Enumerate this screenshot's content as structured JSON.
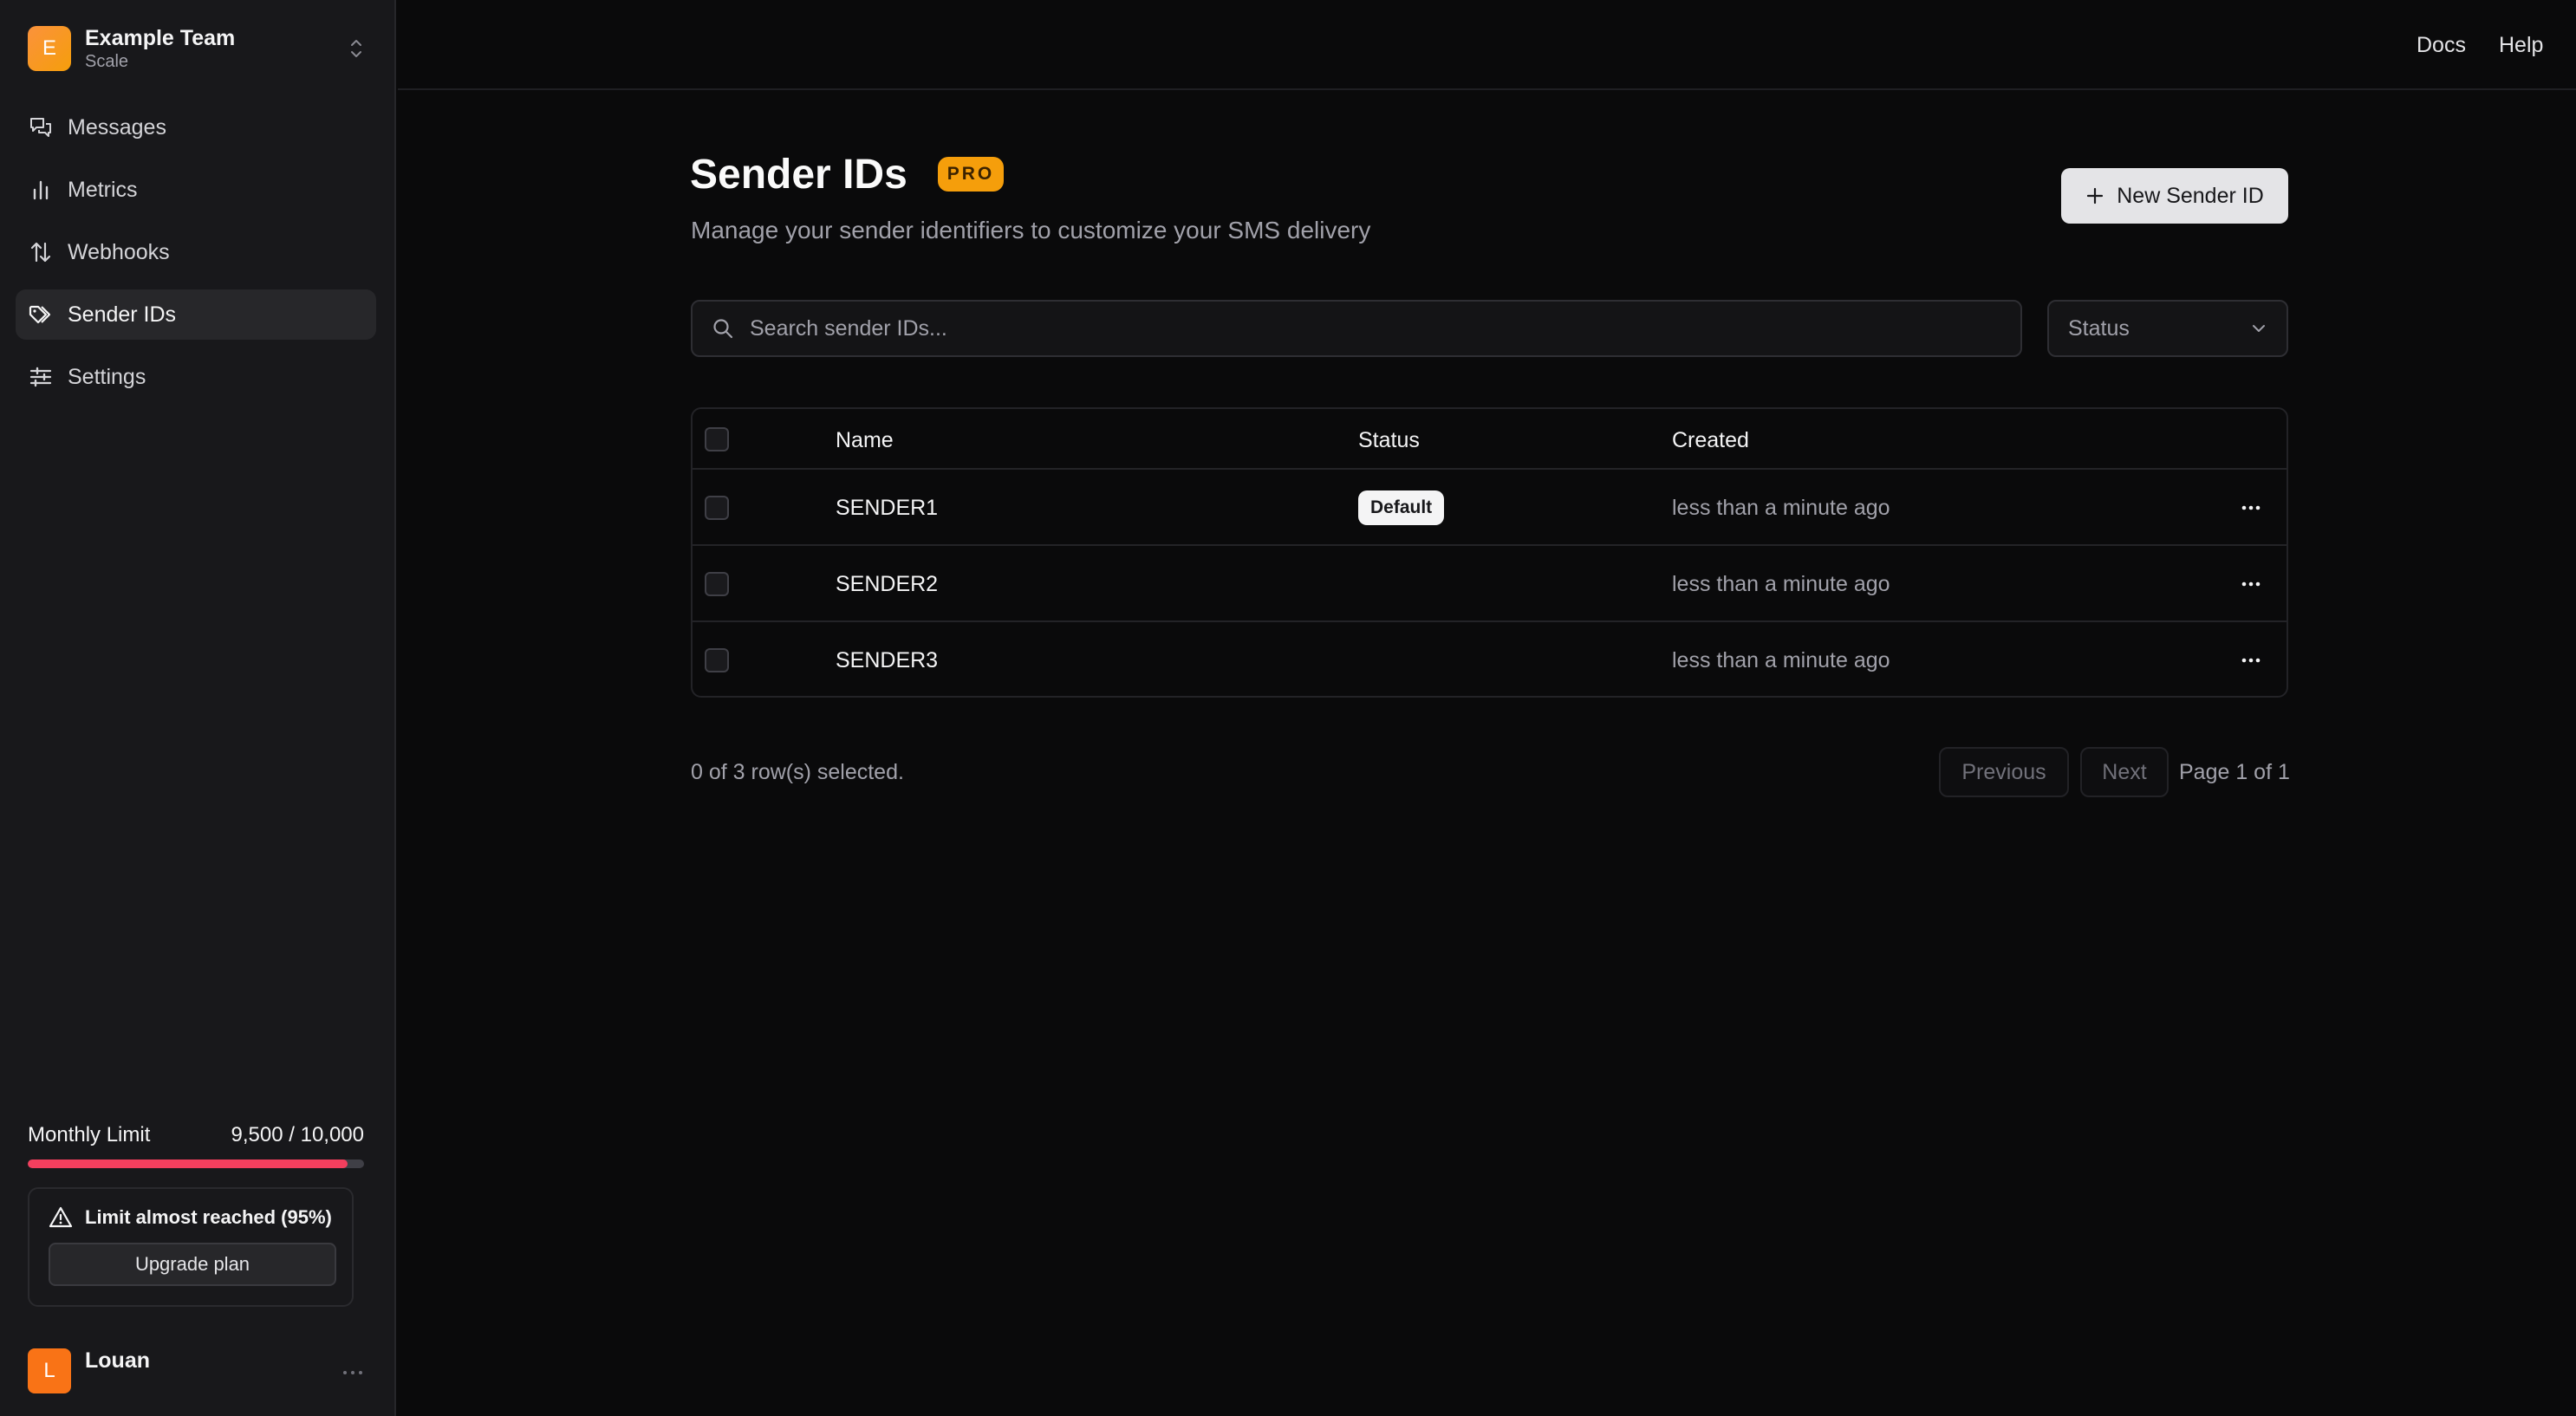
{
  "team": {
    "initial": "E",
    "name": "Example Team",
    "plan": "Scale"
  },
  "nav": [
    {
      "label": "Messages",
      "icon": "messages-icon"
    },
    {
      "label": "Metrics",
      "icon": "bar-chart-icon"
    },
    {
      "label": "Webhooks",
      "icon": "arrows-up-down-icon"
    },
    {
      "label": "Sender IDs",
      "icon": "tags-icon",
      "active": true
    },
    {
      "label": "Settings",
      "icon": "sliders-icon"
    }
  ],
  "limit": {
    "label": "Monthly Limit",
    "value": "9,500 / 10,000",
    "fraction": 0.95,
    "warning": "Limit almost reached (95%)",
    "upgrade_label": "Upgrade plan"
  },
  "user": {
    "initial": "L",
    "name": "Louan"
  },
  "topbar": {
    "docs": "Docs",
    "help": "Help"
  },
  "page": {
    "title": "Sender IDs",
    "badge": "PRO",
    "subtitle": "Manage your sender identifiers to customize your SMS delivery",
    "new_button": "New Sender ID"
  },
  "search": {
    "placeholder": "Search sender IDs..."
  },
  "status_filter": {
    "label": "Status"
  },
  "table": {
    "columns": {
      "name": "Name",
      "status": "Status",
      "created": "Created"
    },
    "rows": [
      {
        "name": "SENDER1",
        "status": "Default",
        "created": "less than a minute ago"
      },
      {
        "name": "SENDER2",
        "status": "",
        "created": "less than a minute ago"
      },
      {
        "name": "SENDER3",
        "status": "",
        "created": "less than a minute ago"
      }
    ]
  },
  "footer": {
    "selection": "0 of 3 row(s) selected.",
    "previous": "Previous",
    "next": "Next",
    "page": "Page 1 of 1"
  },
  "colors": {
    "accent": "#f59e0b",
    "danger": "#f43f5e",
    "background": "#0a0a0b",
    "sidebar": "#18181b"
  }
}
